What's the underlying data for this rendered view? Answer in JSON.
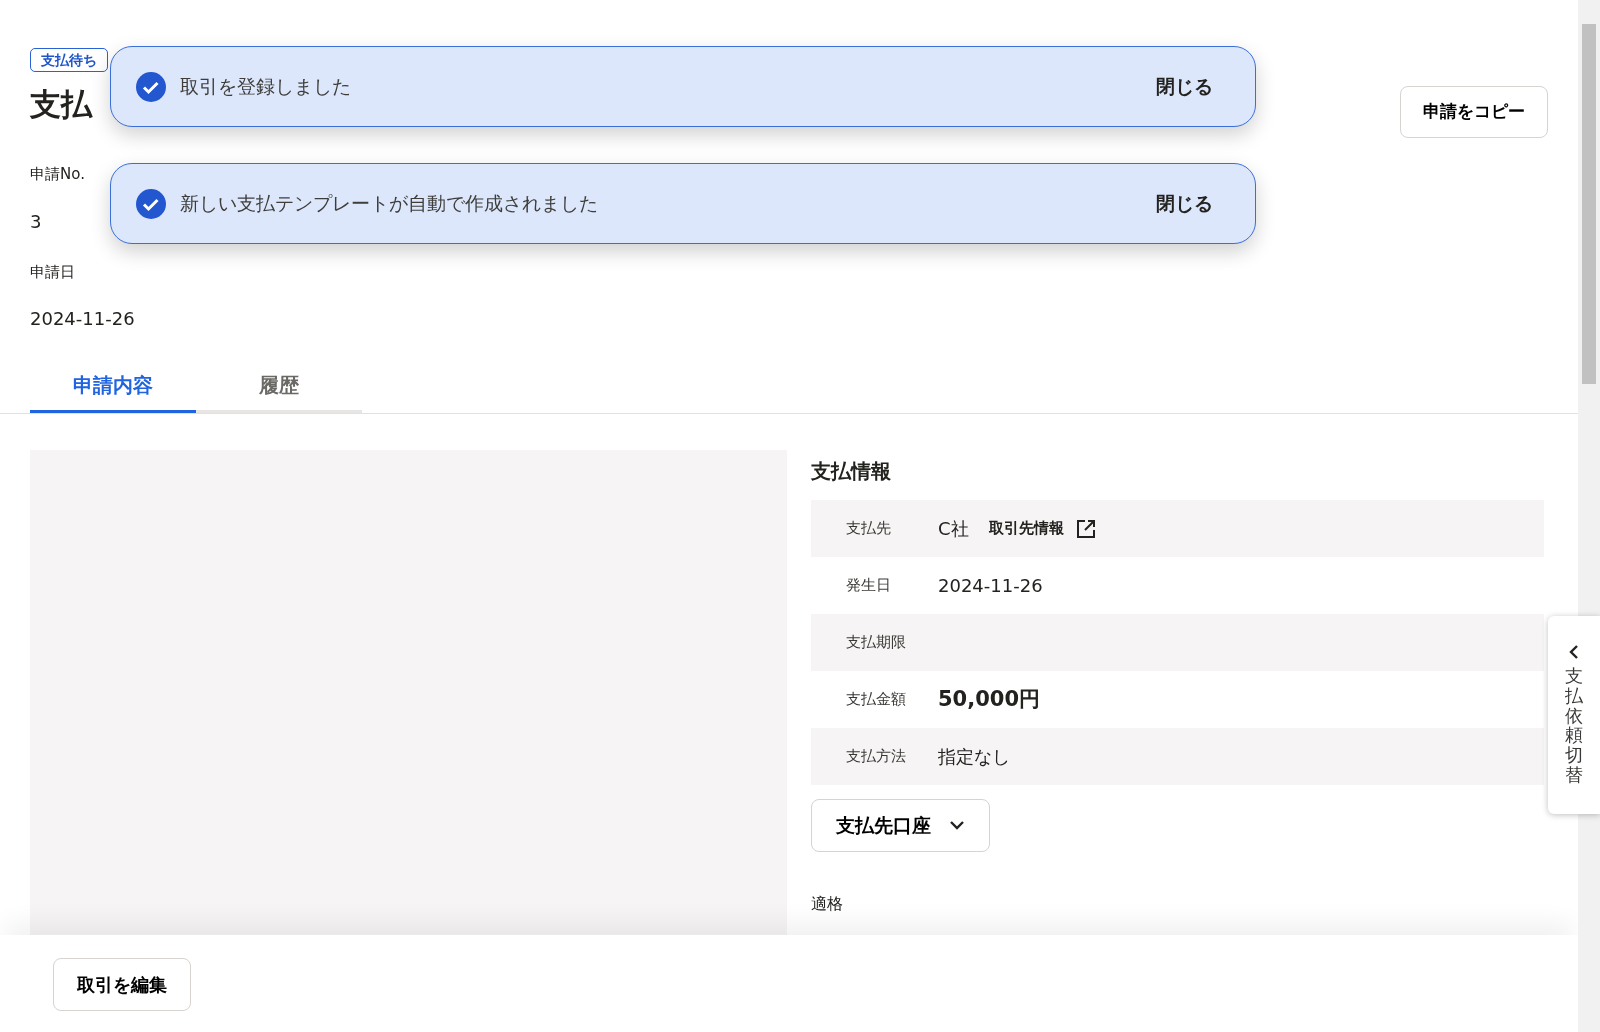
{
  "status_badge": "支払待ち",
  "title": "支払",
  "copy_button": "申請をコピー",
  "toasts": [
    {
      "message": "取引を登録しました",
      "close": "閉じる"
    },
    {
      "message": "新しい支払テンプレートが自動で作成されました",
      "close": "閉じる"
    }
  ],
  "meta": [
    {
      "label": "申請No.",
      "value": "3"
    },
    {
      "label": "申請日",
      "value": "2024-11-26"
    }
  ],
  "tabs": [
    {
      "label": "申請内容",
      "selected": true
    },
    {
      "label": "履歴",
      "selected": false
    }
  ],
  "payment_info": {
    "heading": "支払情報",
    "rows": [
      {
        "label": "支払先",
        "value": "C社",
        "link": "取引先情報",
        "emphasis": false
      },
      {
        "label": "発生日",
        "value": "2024-11-26",
        "emphasis": false
      },
      {
        "label": "支払期限"
      },
      {
        "label": "支払金額",
        "value": "50,000円",
        "emphasis": true
      },
      {
        "label": "支払方法",
        "value": "指定なし",
        "emphasis": false
      }
    ]
  },
  "account_toggle": {
    "label": "支払先口座",
    "expanded": false
  },
  "qualified_label": "適格",
  "side_tab": "支払依頼切替",
  "footer": {
    "edit_button": "取引を編集"
  }
}
